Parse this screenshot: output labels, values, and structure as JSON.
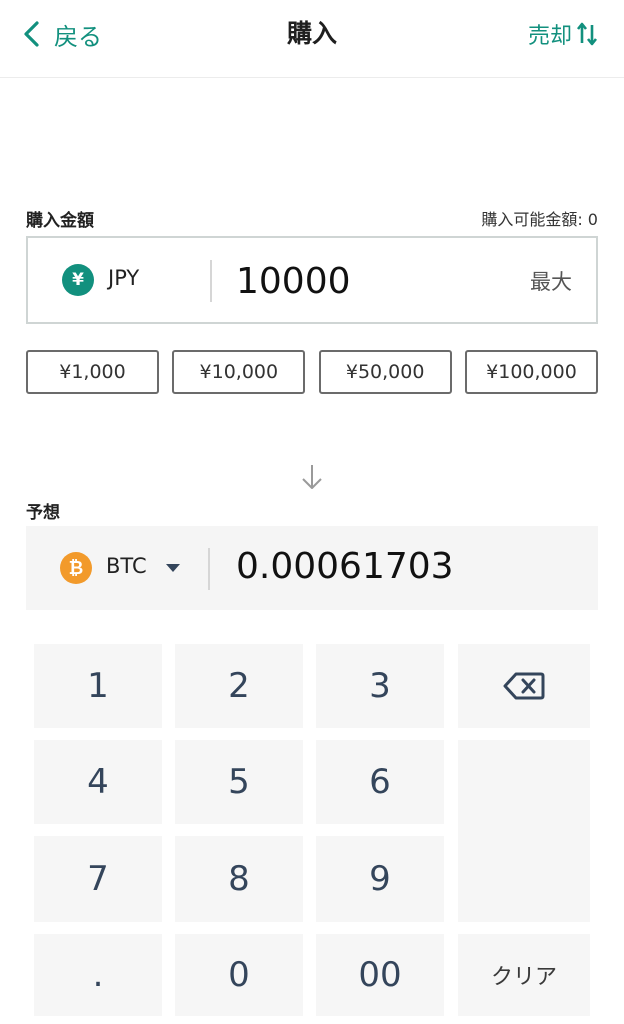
{
  "header": {
    "back_label": "戻る",
    "title": "購入",
    "sell_label": "売却"
  },
  "purchase": {
    "amount_label": "購入金額",
    "available_label": "購入可能金額: 0",
    "currency_symbol": "¥",
    "currency_code": "JPY",
    "amount_value": "10000",
    "max_label": "最大",
    "quick_amounts": [
      "¥1,000",
      "¥10,000",
      "¥50,000",
      "¥100,000"
    ]
  },
  "expected": {
    "label": "予想",
    "currency_symbol": "₿",
    "currency_code": "BTC",
    "value": "0.00061703"
  },
  "keypad": {
    "keys": [
      "1",
      "2",
      "3",
      "4",
      "5",
      "6",
      "7",
      "8",
      "9",
      ".",
      "0",
      "00"
    ],
    "clear_label": "クリア"
  },
  "colors": {
    "accent": "#12907e",
    "btc": "#f29a2b",
    "key_text": "#34455b"
  },
  "icons": {
    "back": "chevron-left-icon",
    "sell": "swap-vertical-icon",
    "arrow": "arrow-down-icon",
    "caret": "caret-down-icon",
    "backspace": "backspace-icon"
  }
}
